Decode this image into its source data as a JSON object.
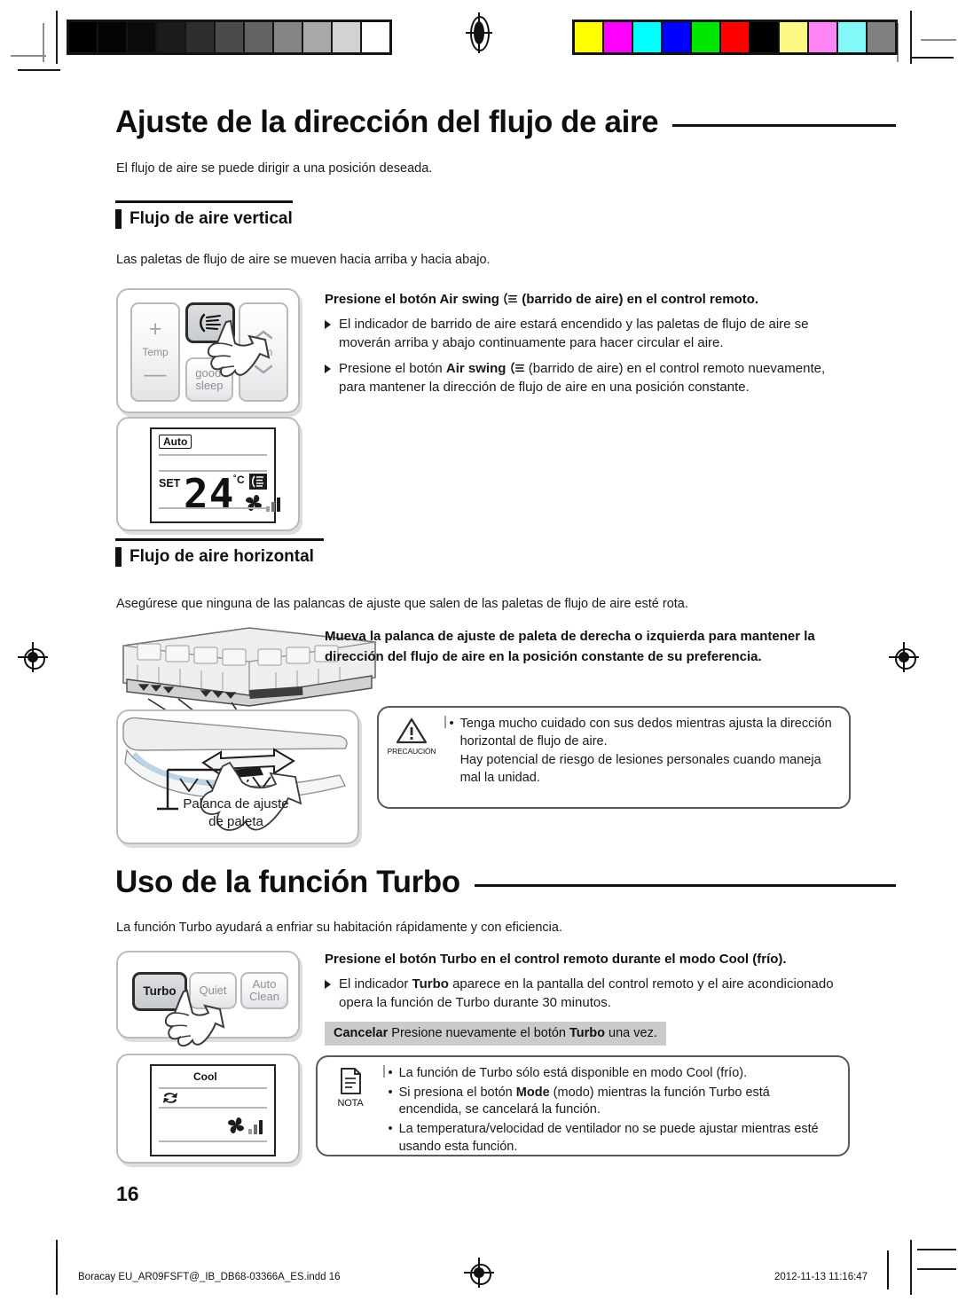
{
  "document": {
    "page_number": "16",
    "footer_file": "Boracay EU_AR09FSFT@_IB_DB68-03366A_ES.indd   16",
    "footer_timestamp": "2012-11-13   11:16:47"
  },
  "calibration": {
    "grayscale": [
      "#000000",
      "#040404",
      "#0b0b0b",
      "#1b1b1b",
      "#2e2e2e",
      "#4b4b4b",
      "#636363",
      "#858585",
      "#a8a8a8",
      "#d2d2d2",
      "#ffffff"
    ],
    "colors": [
      "#ffff00",
      "#ff00ff",
      "#00ffff",
      "#0000ff",
      "#00e600",
      "#ff0000",
      "#000000",
      "#fdf884",
      "#ff86f6",
      "#83f8f8",
      "#808080"
    ]
  },
  "section_airflow": {
    "title": "Ajuste de la dirección del flujo de aire",
    "intro": "El flujo de aire se puede dirigir a una posición deseada.",
    "vertical": {
      "heading": "Flujo de aire vertical",
      "intro": "Las paletas de flujo de aire se mueven hacia arriba y hacia abajo.",
      "lead_before": "Presione el botón Air swing ",
      "lead_after": " (barrido de aire) en el control remoto.",
      "bullets": [
        {
          "part1": "El indicador de barrido de aire estará encendido y las paletas de flujo de aire se moverán arriba y abajo continuamente para hacer circular el aire.",
          "bold": "",
          "part2": ""
        },
        {
          "part1": "Presione el botón ",
          "bold": "Air swing",
          "part2": " (barrido de aire) en el control remoto nuevamente, para mantener la dirección de flujo de aire en una posición constante."
        }
      ],
      "remote": {
        "temp_label": "Temp",
        "temp_plus": "+",
        "temp_minus": "—",
        "fan_label": "Fan",
        "fan_up": "⌃",
        "fan_down": "⌄",
        "good_sleep_line1": "good'",
        "good_sleep_line2": "sleep",
        "air_swing_icon": "air-swing-icon"
      },
      "display": {
        "mode": "Auto",
        "set_label": "SET",
        "temperature": "24",
        "unit": "˚C",
        "icons": [
          "air-swing-icon",
          "fan-speed-icon"
        ]
      }
    },
    "horizontal": {
      "heading": "Flujo de aire horizontal",
      "intro": "Asegúrese que ninguna de las palancas de ajuste que salen de las paletas de flujo de aire esté rota.",
      "lead": "Mueva la palanca de ajuste de paleta de derecha o izquierda para mantener la dirección del flujo de aire en la posición constante de su preferencia.",
      "caption_line1": "Palanca de ajuste",
      "caption_line2": "de paleta",
      "caution": {
        "label": "PRECAUCIÓN",
        "items": [
          "Tenga mucho cuidado con sus dedos mientras ajusta la dirección horizontal de flujo de aire.",
          "Hay potencial de riesgo de lesiones personales cuando maneja mal la unidad."
        ]
      }
    }
  },
  "section_turbo": {
    "title": "Uso de la función Turbo",
    "intro": "La función Turbo ayudará a enfriar su habitación rápidamente y con eficiencia.",
    "lead": "Presione el botón Turbo en el control remoto durante el modo Cool (frío).",
    "bullets": [
      {
        "part1": "El indicador ",
        "bold": "Turbo",
        "part2": " aparece en la pantalla del control remoto y el aire acondicionado opera la función de Turbo durante 30 minutos."
      }
    ],
    "cancel": {
      "label": "Cancelar",
      "before": "  Presione nuevamente el botón ",
      "bold": "Turbo",
      "after": " una vez."
    },
    "remote": {
      "turbo": "Turbo",
      "quiet": "Quiet",
      "auto_clean_line1": "Auto",
      "auto_clean_line2": "Clean"
    },
    "display": {
      "mode": "Cool",
      "turbo_icon": "turbo-indicator-icon",
      "fan_icon": "fan-speed-icon"
    },
    "note": {
      "label": "NOTA",
      "items": [
        {
          "part1": "La función de Turbo sólo está disponible en modo Cool (frío).",
          "bold": "",
          "part2": ""
        },
        {
          "part1": "Si presiona el botón  ",
          "bold": "Mode",
          "part2": " (modo) mientras la función Turbo está encendida, se cancelará la función."
        },
        {
          "part1": "La temperatura/velocidad de ventilador no se puede ajustar mientras esté usando esta función.",
          "bold": "",
          "part2": ""
        }
      ]
    }
  }
}
